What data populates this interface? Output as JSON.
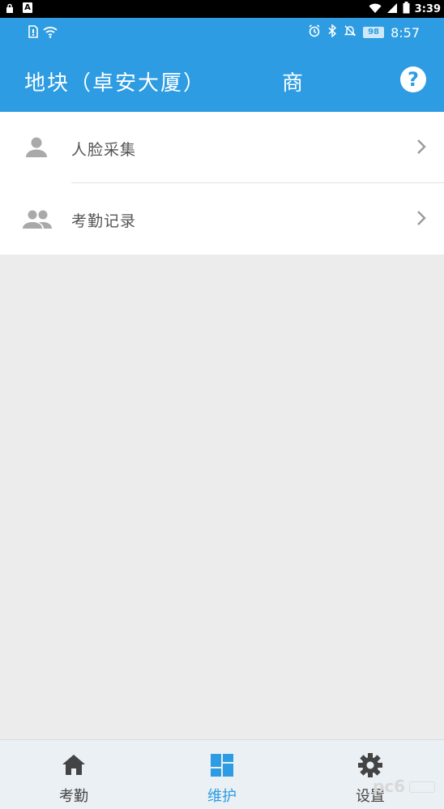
{
  "system_bar": {
    "left_letter": "A",
    "time": "3:39"
  },
  "app_status": {
    "battery": "98",
    "time": "8:57"
  },
  "header": {
    "title": "地块（卓安大厦）",
    "title_tail": "商",
    "help_glyph": "?"
  },
  "menu": {
    "items": [
      {
        "label": "人脸采集",
        "icon": "person-icon"
      },
      {
        "label": "考勤记录",
        "icon": "people-icon"
      }
    ]
  },
  "bottom_nav": {
    "tabs": [
      {
        "label": "考勤",
        "icon": "home-icon"
      },
      {
        "label": "维护",
        "icon": "dashboard-icon",
        "active": true
      },
      {
        "label": "设置",
        "icon": "gear-icon"
      }
    ]
  },
  "colors": {
    "primary": "#2d9ce2",
    "background": "#ececec"
  }
}
